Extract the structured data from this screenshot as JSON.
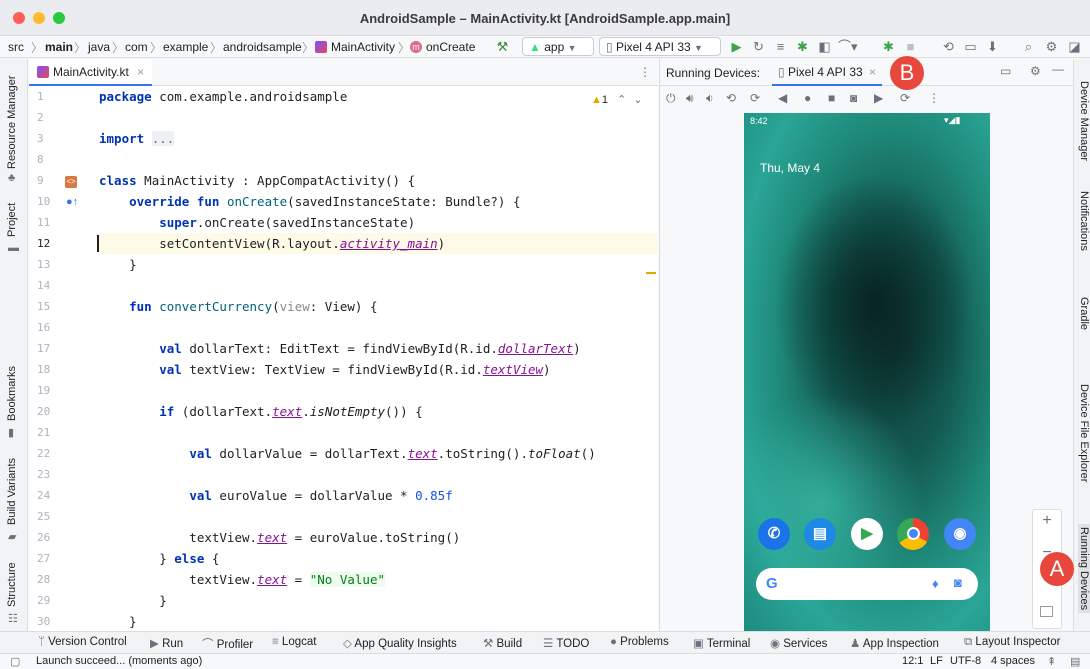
{
  "window": {
    "title": "AndroidSample – MainActivity.kt [AndroidSample.app.main]"
  },
  "breadcrumb": [
    "src",
    "main",
    "java",
    "com",
    "example",
    "androidsample",
    "MainActivity",
    "onCreate"
  ],
  "run_config": {
    "module": "app",
    "device": "Pixel 4 API 33"
  },
  "left_tabs": [
    "Resource Manager",
    "Project",
    "Bookmarks",
    "Build Variants",
    "Structure"
  ],
  "right_tabs": [
    "Device Manager",
    "Notifications",
    "Gradle",
    "Device File Explorer",
    "Running Devices"
  ],
  "editor": {
    "tab_label": "MainActivity.kt",
    "warning_count": "1",
    "line_numbers": [
      "1",
      "2",
      "3",
      "8",
      "9",
      "10",
      "11",
      "12",
      "13",
      "14",
      "15",
      "16",
      "17",
      "18",
      "19",
      "20",
      "21",
      "22",
      "23",
      "24",
      "25",
      "26",
      "27",
      "28",
      "29",
      "30"
    ]
  },
  "running_devices": {
    "label": "Running Devices:",
    "device_tab": "Pixel 4 API 33",
    "screen": {
      "time": "8:42",
      "date": "Thu, May 4"
    }
  },
  "bottom_tools": [
    "Version Control",
    "Run",
    "Profiler",
    "Logcat",
    "App Quality Insights",
    "Build",
    "TODO",
    "Problems",
    "Terminal",
    "Services",
    "App Inspection",
    "Layout Inspector"
  ],
  "status": {
    "message": "Launch succeed... (moments ago)",
    "position": "12:1",
    "line_sep": "LF",
    "encoding": "UTF-8",
    "indent": "4 spaces"
  },
  "callouts": {
    "a": "A",
    "b": "B"
  },
  "colors": {
    "accent": "#3574f0",
    "callout": "#e8473d"
  }
}
